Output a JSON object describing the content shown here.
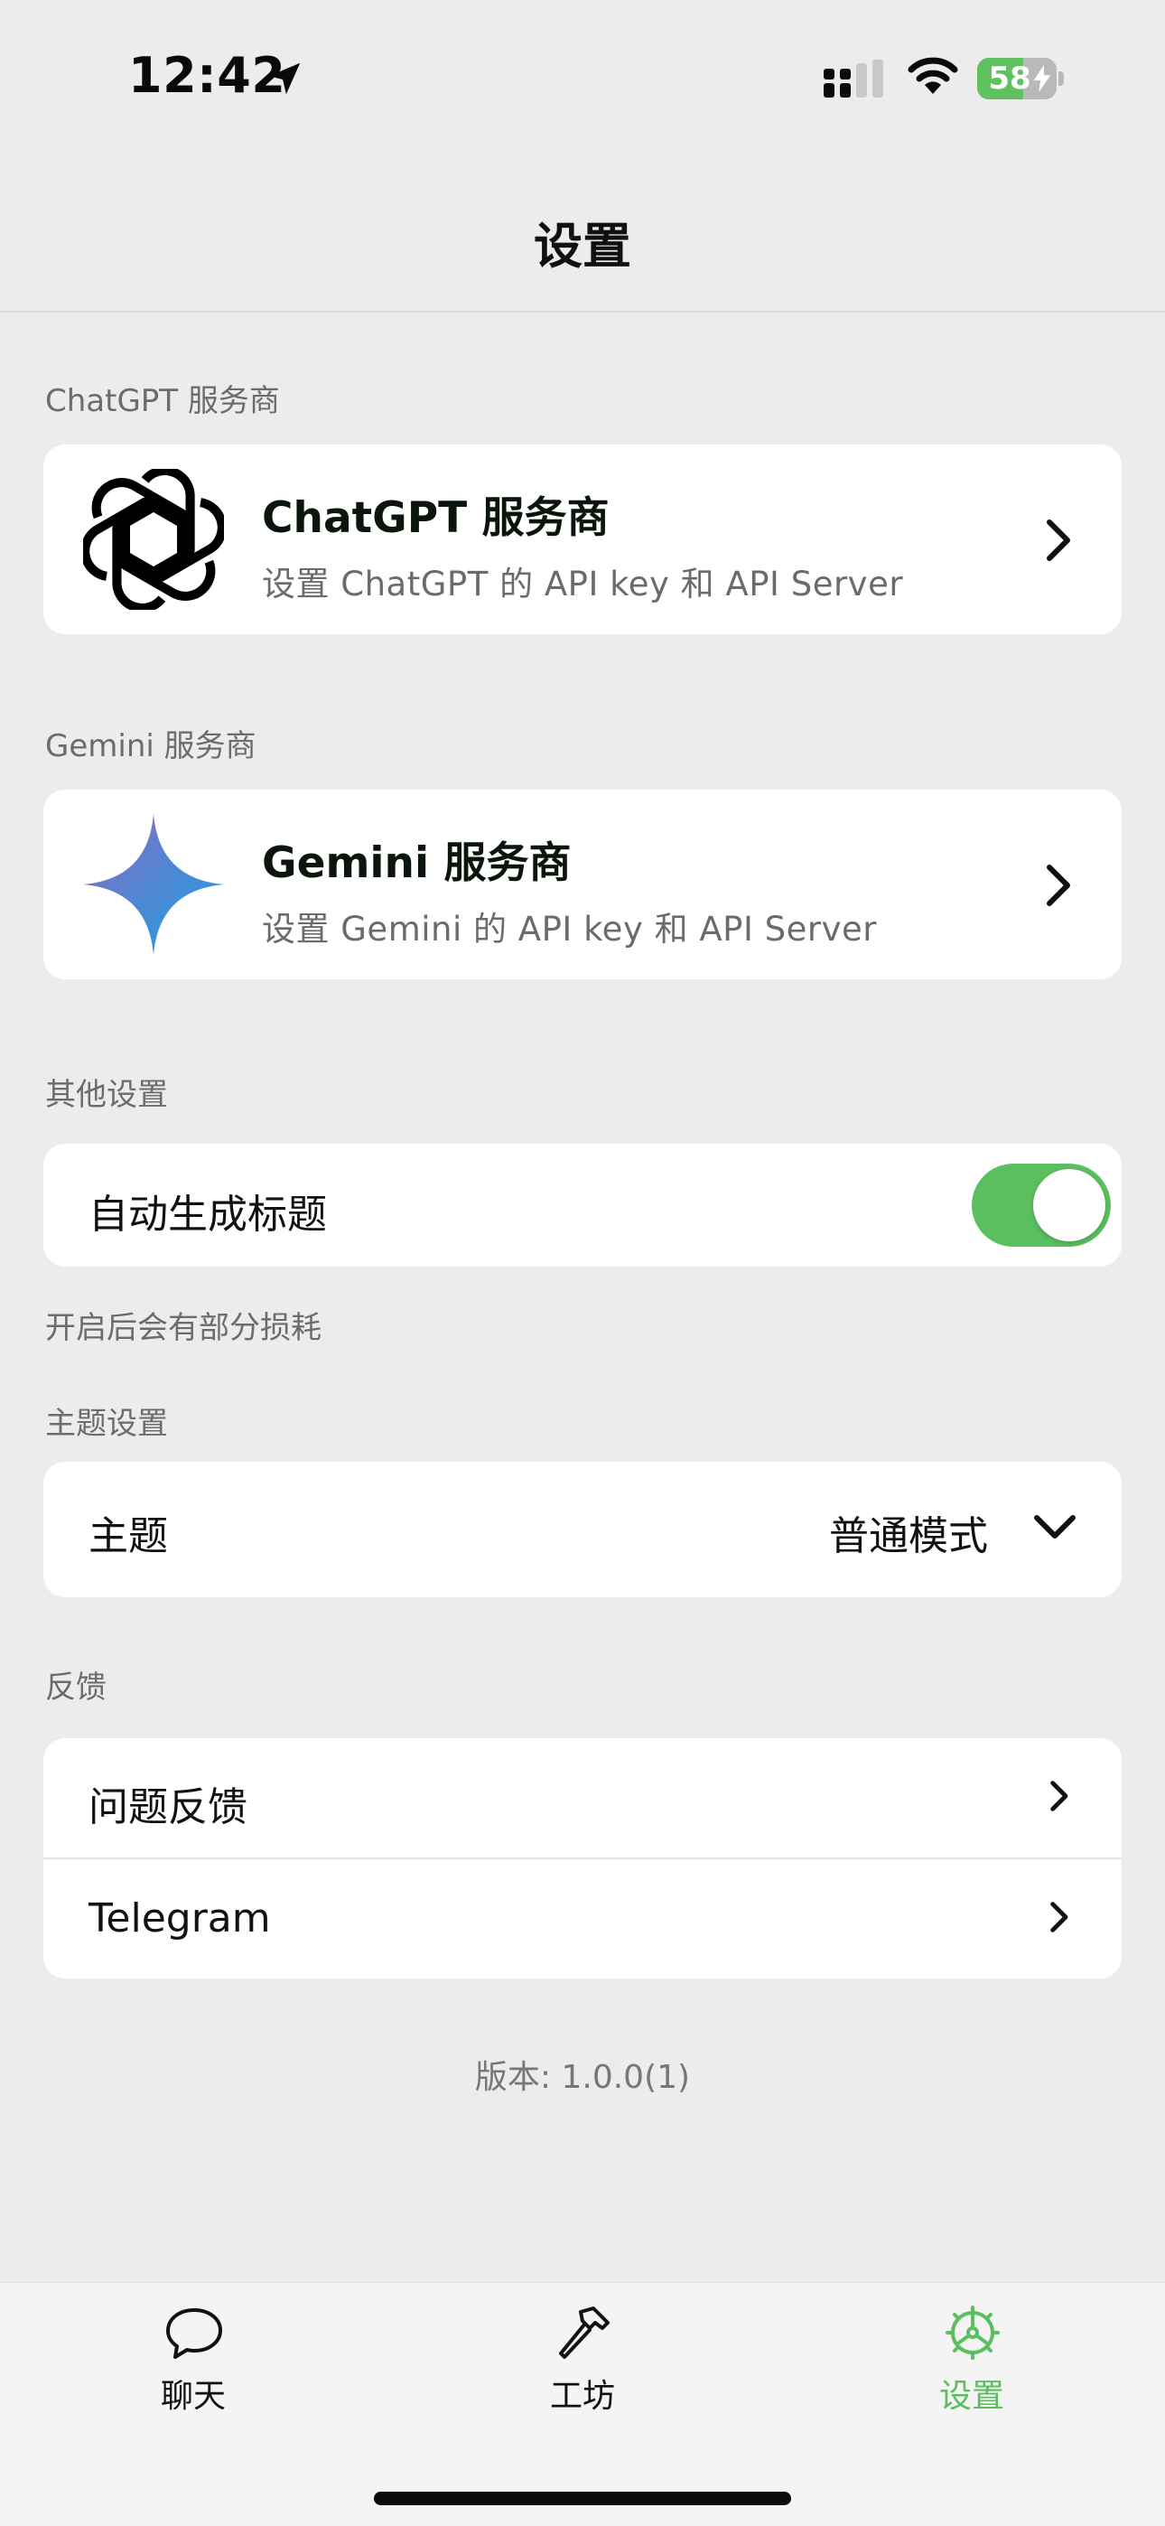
{
  "status_bar": {
    "time": "12:42",
    "battery_percent": "58",
    "battery_level": 0.58,
    "battery_charging": true
  },
  "header": {
    "title": "设置"
  },
  "chatgpt": {
    "section_label": "ChatGPT 服务商",
    "title": "ChatGPT 服务商",
    "subtitle": "设置 ChatGPT 的 API key 和 API Server",
    "icon": "openai-logo-icon"
  },
  "gemini": {
    "section_label": "Gemini 服务商",
    "title": "Gemini 服务商",
    "subtitle": "设置 Gemini 的 API key 和 API Server",
    "icon": "gemini-logo-icon"
  },
  "other": {
    "section_label": "其他设置",
    "auto_title_label": "自动生成标题",
    "auto_title_enabled": true,
    "footer_note": "开启后会有部分损耗"
  },
  "theme": {
    "section_label": "主题设置",
    "label": "主题",
    "value": "普通模式"
  },
  "feedback": {
    "section_label": "反馈",
    "items": [
      {
        "label": "问题反馈"
      },
      {
        "label": "Telegram"
      }
    ]
  },
  "version": "版本: 1.0.0(1)",
  "tabs": [
    {
      "label": "聊天",
      "icon": "chat-bubble-icon",
      "active": false
    },
    {
      "label": "工坊",
      "icon": "hammer-icon",
      "active": false
    },
    {
      "label": "设置",
      "icon": "gear-icon",
      "active": true
    }
  ],
  "colors": {
    "accent": "#5cbf5f",
    "background": "#ececec",
    "card": "#ffffff"
  }
}
